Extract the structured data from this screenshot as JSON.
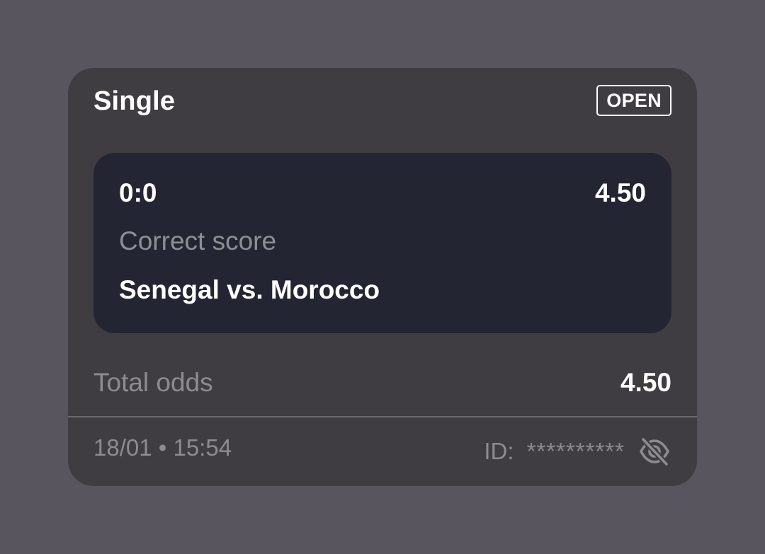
{
  "colors": {
    "page_background": "#59555f",
    "card_background": "#403d42",
    "selection_background": "#232632",
    "primary_text": "#ffffff",
    "muted_text": "#8d8b92"
  },
  "bet": {
    "type": "Single",
    "status": "OPEN"
  },
  "selection": {
    "score": "0:0",
    "odds": "4.50",
    "market": "Correct score",
    "event": "Senegal vs. Morocco"
  },
  "summary": {
    "total_label": "Total odds",
    "total_value": "4.50"
  },
  "footer": {
    "timestamp": "18/01 • 15:54",
    "id_label": "ID:",
    "id_value": "**********",
    "visibility_icon": "eye-off-icon"
  }
}
